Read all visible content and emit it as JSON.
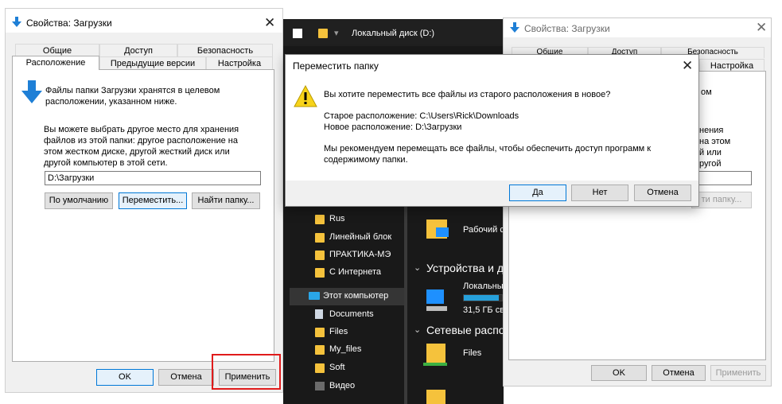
{
  "left_dialog": {
    "title": "Свойства: Загрузки",
    "tabs_row1": [
      "Общие",
      "Доступ",
      "Безопасность"
    ],
    "tabs_row2": [
      "Расположение",
      "Предыдущие версии",
      "Настройка"
    ],
    "info_text": "Файлы папки Загрузки хранятся в целевом расположении, указанном ниже.",
    "choose_text": "Вы можете выбрать другое место для хранения файлов из этой папки: другое расположение на этом жестком диске, другой жесткий диск или другой компьютер в этой сети.",
    "path_value": "D:\\Загрузки",
    "btn_default": "По умолчанию",
    "btn_move": "Переместить...",
    "btn_find": "Найти папку...",
    "btn_ok": "OK",
    "btn_cancel": "Отмена",
    "btn_apply": "Применить"
  },
  "explorer": {
    "address": "Локальный диск (D:)",
    "nav_items": [
      "Rus",
      "Линейный блок",
      "ПРАКТИКА-МЭ",
      "С Интернета"
    ],
    "this_pc": "Этот компьютер",
    "pc_items": [
      "Documents",
      "Files",
      "My_files",
      "Soft",
      "Видео"
    ],
    "desktop_label": "Рабочий с",
    "devices_heading": "Устройства и д",
    "drive_label": "Локальны",
    "drive_free": "31,5 ГБ св",
    "network_heading": "Сетевые распо",
    "files_label": "Files",
    "colors": {
      "background": "#191919",
      "folder": "#f5c23c",
      "accent": "#1e90ff"
    }
  },
  "right_dialog": {
    "title": "Свойства: Загрузки",
    "tabs_row1": [
      "Общие",
      "Доступ",
      "Безопасность"
    ],
    "tab_visible": "Настройка",
    "fragments": [
      "ом",
      "нения",
      "на этом",
      "й или",
      "ругой"
    ],
    "btn_find": "ти папку...",
    "btn_ok": "OK",
    "btn_cancel": "Отмена",
    "btn_apply": "Применить"
  },
  "move_dialog": {
    "title": "Переместить папку",
    "question": "Вы хотите переместить все файлы из старого расположения в новое?",
    "old_location": "Старое расположение: C:\\Users\\Rick\\Downloads",
    "new_location": "Новое расположение: D:\\Загрузки",
    "recommendation": "Мы рекомендуем перемещать все файлы, чтобы обеспечить доступ программ к содержимому папки.",
    "btn_yes": "Да",
    "btn_no": "Нет",
    "btn_cancel": "Отмена"
  }
}
